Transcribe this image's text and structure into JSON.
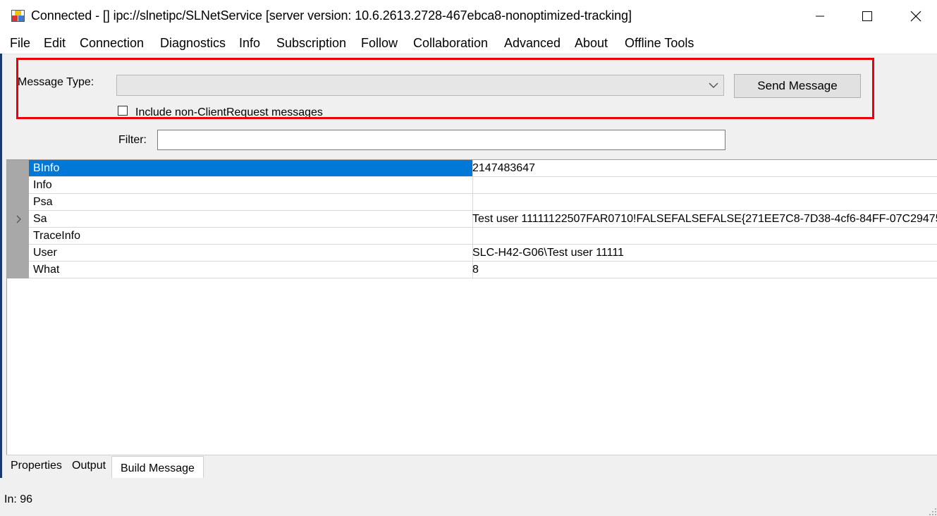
{
  "window": {
    "title": "Connected - [] ipc://slnetipc/SLNetService [server version: 10.6.2613.2728-467ebca8-nonoptimized-tracking]",
    "icon": "app-icon",
    "controls": [
      "minimize-icon",
      "maximize-icon",
      "close-icon"
    ]
  },
  "menu": {
    "items": [
      "File",
      "Edit",
      "Connection",
      "Diagnostics",
      "Info",
      "Subscription",
      "Follow",
      "Collaboration",
      "Advanced",
      "About",
      "Offline Tools"
    ]
  },
  "form": {
    "message_type_label": "Message Type:",
    "message_type_value": "",
    "send_button": "Send Message",
    "include_checkbox_label": "Include non-ClientRequest messages",
    "include_checkbox_checked": false,
    "filter_label": "Filter:",
    "filter_value": ""
  },
  "grid": {
    "rows": [
      {
        "name": "BInfo",
        "value": "2147483647",
        "selected": true
      },
      {
        "name": "Info",
        "value": ""
      },
      {
        "name": "Psa",
        "value": ""
      },
      {
        "name": "Sa",
        "value": "Test user 11111122507FAR0710!FALSEFALSEFALSE{271EE7C8-7D38-4cf6-84FF-07C29475",
        "current": true
      },
      {
        "name": "TraceInfo",
        "value": ""
      },
      {
        "name": "User",
        "value": "SLC-H42-G06\\Test user 11111"
      },
      {
        "name": "What",
        "value": "8"
      }
    ]
  },
  "tabs": {
    "items": [
      "Properties",
      "Output",
      "Build Message"
    ],
    "active": "Build Message"
  },
  "status": {
    "text": "In: 96"
  },
  "colors": {
    "selection": "#0078d7",
    "highlight_box": "#e8000b",
    "window_bg": "#f0f0f0"
  }
}
